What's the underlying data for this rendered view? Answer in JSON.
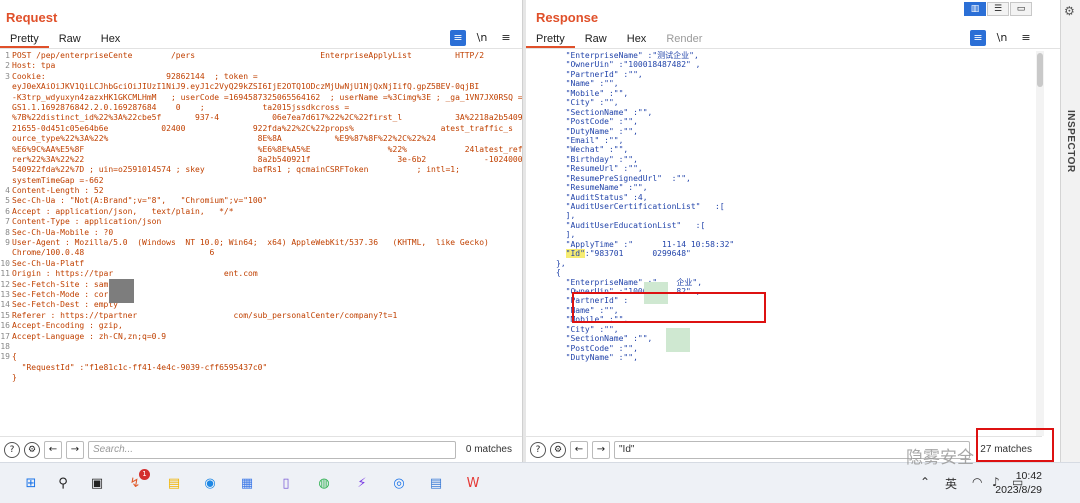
{
  "request": {
    "title": "Request",
    "tabs": [
      "Pretty",
      "Raw",
      "Hex"
    ],
    "active_tab": "Pretty",
    "tool_icons": [
      "wrap-icon",
      "newline-icon",
      "menu-icon"
    ],
    "lines": [
      {
        "n": "1",
        "t": "POST /pep/enterpriseCente        /pers                          EnterpriseApplyList         HTTP/2"
      },
      {
        "n": "2",
        "t": "Host: tpa"
      },
      {
        "n": "3",
        "t": "Cookie:                         92862144  ; token ="
      },
      {
        "n": "",
        "t": "eyJ0eXAiOiJKV1QiLCJhbGciOiJIUzI1NiJ9.eyJ1c2VyQ29kZSI6IjE2OTQ1ODczMjUwNjU1NjQxNjIifQ.gpZ5BEV-0qjBI"
      },
      {
        "n": "",
        "t": "-K3trp_wdyuxyn4zazxHK1GKCMLHmM   ; userCode =1694587325065564162  ; userName =%3Cimg%3E ; _ga_1VN7JX0RSQ ="
      },
      {
        "n": "",
        "t": "GS1.1.1692876842.2.0.169287684    0    ;            ta2015jssdkcross ="
      },
      {
        "n": "",
        "t": "%7B%22distinct_id%22%3A%22cbe5f       937-4           06e7ea7d617%22%2C%22first_l           3A%2218a2b5409"
      },
      {
        "n": "",
        "t": "21655-0d451c05e64b6e           02400              922fda%22%2C%22props%                  atest_traffic_s"
      },
      {
        "n": "",
        "t": "ource_type%22%3A%22%                               8E%8A           %E9%87%8F%22%2C%22%24                  eyword%22%3A%22"
      },
      {
        "n": "",
        "t": "%E6%9C%AA%E5%8F                                    %E6%8E%A5%E                %22%            24latest_refer"
      },
      {
        "n": "",
        "t": "rer%22%3A%22%22                                    8a2b540921f                  3e-6b2            -1024000-18a2b"
      },
      {
        "n": "",
        "t": "540922fda%22%7D ; uin=o2591014574 ; skey          bafRs1 ; qcmainCSRFToken          ; intl=1;"
      },
      {
        "n": "",
        "t": "systemTimeGap =-662"
      },
      {
        "n": "4",
        "t": "Content-Length : 52"
      },
      {
        "n": "5",
        "t": "Sec-Ch-Ua : \"Not(A:Brand\";v=\"8\",   \"Chromium\";v=\"100\""
      },
      {
        "n": "6",
        "t": "Accept : application/json,   text/plain,   */*"
      },
      {
        "n": "7",
        "t": "Content-Type : application/json"
      },
      {
        "n": "8",
        "t": "Sec-Ch-Ua-Mobile : ?0"
      },
      {
        "n": "9",
        "t": "User-Agent : Mozilla/5.0  (Windows  NT 10.0; Win64;  x64) AppleWebKit/537.36   (KHTML,  like Gecko)"
      },
      {
        "n": "",
        "t": "Chrome/100.0.48                          6"
      },
      {
        "n": "10",
        "t": "Sec-Ch-Ua-Platf"
      },
      {
        "n": "11",
        "t": "Origin : https://tpar                       ent.com"
      },
      {
        "n": "12",
        "t": "Sec-Fetch-Site : sam"
      },
      {
        "n": "13",
        "t": "Sec-Fetch-Mode : cors"
      },
      {
        "n": "14",
        "t": "Sec-Fetch-Dest : empty"
      },
      {
        "n": "15",
        "t": "Referer : https://tpartner                    com/sub_personalCenter/company?t=1"
      },
      {
        "n": "16",
        "t": "Accept-Encoding : gzip, "
      },
      {
        "n": "17",
        "t": "Accept-Language : zh-CN,zn;q=0.9"
      },
      {
        "n": "18",
        "t": ""
      },
      {
        "n": "19",
        "t": "{"
      },
      {
        "n": "",
        "t": "  \"RequestId\" :\"f1e81c1c-ff41-4e4c-9039-cff6595437c0\""
      },
      {
        "n": "",
        "t": "}"
      }
    ],
    "search_placeholder": "Search...",
    "matches": "0 matches"
  },
  "response": {
    "title": "Response",
    "tabs": [
      "Pretty",
      "Raw",
      "Hex",
      "Render"
    ],
    "active_tab": "Pretty",
    "disabled_tab": "Render",
    "tool_icons": [
      "wrap-icon",
      "newline-icon",
      "menu-icon"
    ],
    "view_buttons": [
      "split-horizontal-icon",
      "split-vertical-icon",
      "single-pane-icon"
    ],
    "lines": [
      "  \"EnterpriseName\" :\"测试企业\",",
      "  \"OwnerUin\" :\"100018487482\" ,",
      "  \"PartnerId\" :\"\",",
      "  \"Name\" :\"\",",
      "  \"Mobile\" :\"\",",
      "  \"City\" :\"\",",
      "  \"SectionName\" :\"\",",
      "  \"PostCode\" :\"\",",
      "  \"DutyName\" :\"\",",
      "  \"Email\" :\"\",",
      "  \"Wechat\" :\"\",",
      "  \"Birthday\" :\"\",",
      "  \"ResumeUrl\" :\"\",",
      "  \"ResumePreSignedUrl\"  :\"\",",
      "  \"ResumeName\" :\"\",",
      "  \"AuditStatus\" :4,",
      "  \"AuditUserCertificationList\"   :[",
      "  ],",
      "  \"AuditUserEducationList\"   :[",
      "  ],",
      "  \"ApplyTime\" :\"      11-14 10:58:32\"",
      "  \"Id\":\"983701      0299648\"",
      "},",
      "{",
      "  \"EnterpriseName\" :\"    企业\",",
      "  \"OwnerUin\" :\"10001     82\" ,",
      "  \"PartnerId\" :",
      "  \"Name\" :\"\",",
      "  \"Mobile\" :\"\",",
      "  \"City\" :\"\",",
      "  \"SectionName\" :\"\",",
      "  \"PostCode\" :\"\",",
      "  \"DutyName\" :\"\","
    ],
    "highlight_key": "\"Id\"",
    "search_value": "\"Id\"",
    "matches": "27 matches"
  },
  "inspector": {
    "label": "INSPECTOR"
  },
  "taskbar": {
    "apps": [
      "windows-start-icon",
      "search-icon",
      "taskview-icon",
      "burp-icon",
      "file-explorer-icon",
      "edge-icon",
      "store-icon",
      "phone-link-icon",
      "wechat-icon",
      "tool-icon",
      "chrome-icon",
      "notepad-icon",
      "wps-icon"
    ],
    "badge": "1",
    "tray": [
      "chevron-up-icon",
      "英",
      "wifi-icon",
      "speaker-icon",
      "battery-icon"
    ],
    "ime": "英",
    "time": "10:42",
    "date": "2023/8/29"
  },
  "watermark": "隐雾安全"
}
